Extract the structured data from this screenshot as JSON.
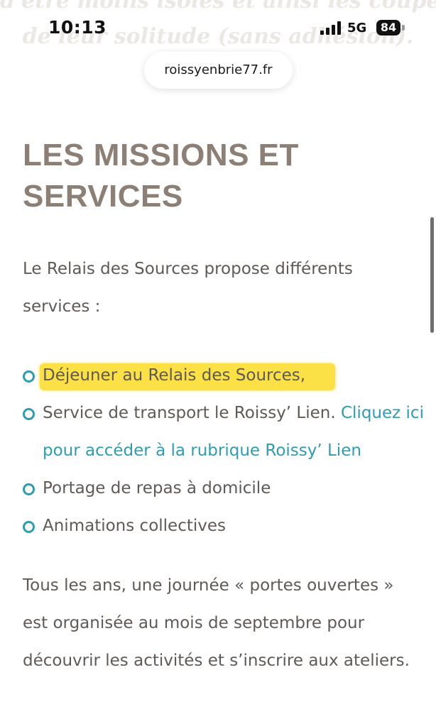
{
  "background_text": {
    "line1": "d'être moins isolés et ainsi les couper",
    "line2": "de leur solitude (sans adhésion)."
  },
  "status_bar": {
    "time": "10:13",
    "network": "5G",
    "battery": "84",
    "signal_icon": "cellular-signal-icon"
  },
  "browser": {
    "url": "roissyenbrie77.fr"
  },
  "heading": {
    "line1": "LES MISSIONS ET",
    "line2": "SERVICES"
  },
  "intro": "Le Relais des Sources propose différents services :",
  "services": {
    "item1": "Déjeuner au Relais des Sources,",
    "item2_text": "Service de transport le Roissy’ Lien. ",
    "item2_link": "Cliquez ici pour accéder à la rubrique Roissy’ Lien",
    "item3": "Portage de repas à domicile",
    "item4": "Animations collectives"
  },
  "footer_paragraph": "Tous les ans, une journée « portes ouvertes » est organisée au mois de septembre pour découvrir les activités et s’inscrire aux ateliers.",
  "colors": {
    "heading": "#8b7f76",
    "body_text": "#5f5a56",
    "accent": "#2e9db0",
    "highlight": "#fbe046"
  }
}
